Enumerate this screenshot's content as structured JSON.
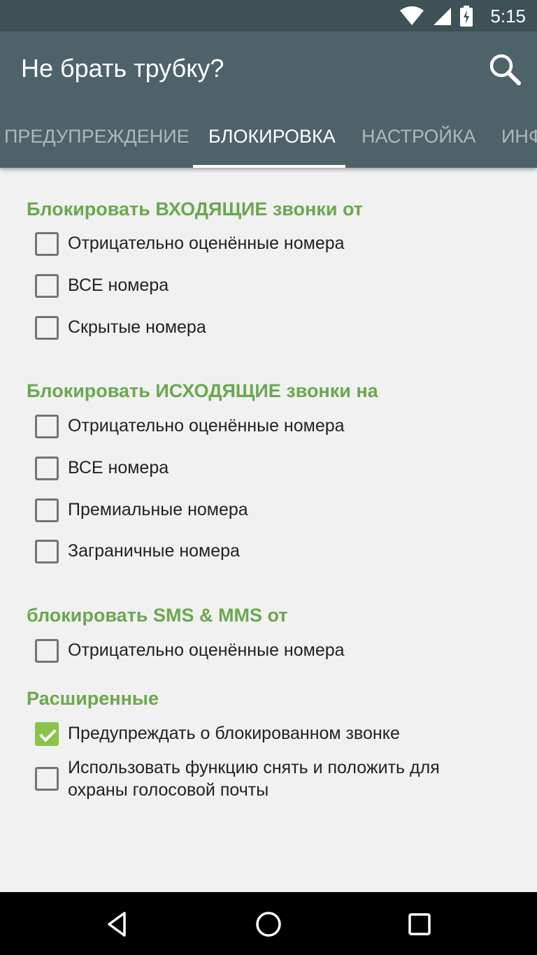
{
  "status_bar": {
    "time": "5:15",
    "icons": [
      "wifi-icon",
      "signal-icon",
      "battery-icon"
    ]
  },
  "app_bar": {
    "title": "Не брать трубку?",
    "search_icon": "search-icon"
  },
  "tabs": [
    {
      "label": "ПРЕДУПРЕЖДЕНИЕ",
      "active": false
    },
    {
      "label": "БЛОКИРОВКА",
      "active": true
    },
    {
      "label": "НАСТРОЙКА",
      "active": false
    },
    {
      "label": "ИНФ",
      "active": false
    }
  ],
  "sections": [
    {
      "title": "Блокировать ВХОДЯЩИЕ звонки от",
      "items": [
        {
          "label": "Отрицательно оценённые номера",
          "checked": false
        },
        {
          "label": "ВСЕ номера",
          "checked": false
        },
        {
          "label": "Скрытые номера",
          "checked": false
        }
      ]
    },
    {
      "title": "Блокировать ИСХОДЯЩИЕ звонки на",
      "items": [
        {
          "label": "Отрицательно оценённые номера",
          "checked": false
        },
        {
          "label": "ВСЕ номера",
          "checked": false
        },
        {
          "label": "Премиальные номера",
          "checked": false
        },
        {
          "label": "Заграничные номера",
          "checked": false
        }
      ]
    },
    {
      "title": "блокировать SMS & MMS от",
      "items": [
        {
          "label": "Отрицательно оценённые номера",
          "checked": false
        }
      ]
    },
    {
      "title": "Расширенные",
      "items": [
        {
          "label": "Предупреждать о блокированном звонке",
          "checked": true
        },
        {
          "label": "Использовать функцию снять и положить для охраны голосовой почты",
          "checked": false
        }
      ]
    }
  ],
  "colors": {
    "accent": "#6aa84f",
    "checkbox_checked": "#8bc34a",
    "app_bar": "#4e6369",
    "status_bar": "#3d5156"
  },
  "nav_bar": {
    "icons": [
      "back-icon",
      "home-icon",
      "recents-icon"
    ]
  }
}
